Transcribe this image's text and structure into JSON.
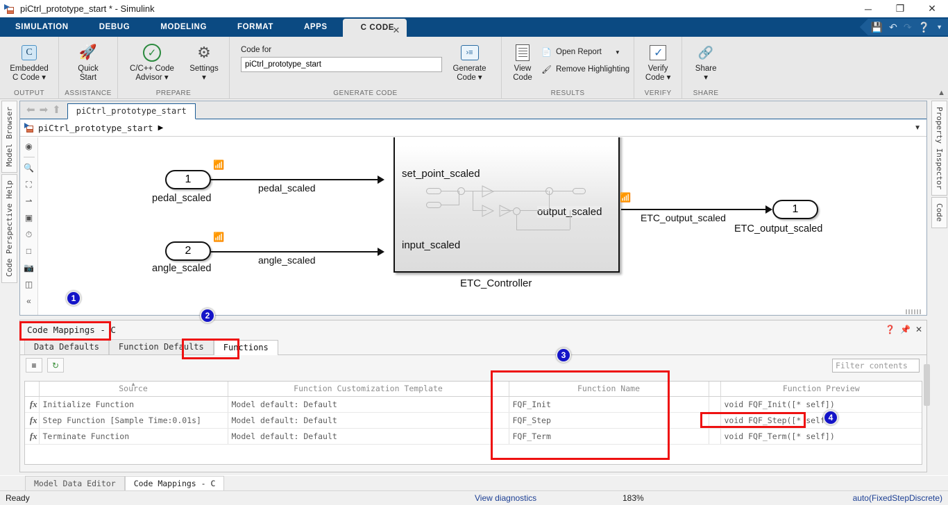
{
  "window": {
    "title": "piCtrl_prototype_start * - Simulink",
    "minimize": "─",
    "maximize": "❐",
    "close": "✕"
  },
  "ribbon_tabs": [
    {
      "label": "SIMULATION",
      "selected": false
    },
    {
      "label": "DEBUG",
      "selected": false
    },
    {
      "label": "MODELING",
      "selected": false
    },
    {
      "label": "FORMAT",
      "selected": false
    },
    {
      "label": "APPS",
      "selected": false
    },
    {
      "label": "C CODE",
      "selected": true
    }
  ],
  "quick_access": [
    "save-icon",
    "undo-icon",
    "redo-icon",
    "help-icon",
    "chevron-down-icon"
  ],
  "ribbon": {
    "groups": [
      {
        "name": "OUTPUT",
        "buttons": [
          {
            "label": "Embedded\nC Code ▾",
            "icon": "c-code-icon"
          }
        ]
      },
      {
        "name": "ASSISTANCE",
        "buttons": [
          {
            "label": "Quick\nStart",
            "icon": "rocket-icon"
          }
        ]
      },
      {
        "name": "PREPARE",
        "buttons": [
          {
            "label": "C/C++ Code\nAdvisor ▾",
            "icon": "check-circle-icon"
          },
          {
            "label": "Settings\n▾",
            "icon": "gear-icon"
          }
        ]
      },
      {
        "name": "GENERATE CODE",
        "code_for_label": "Code for",
        "code_for_value": "piCtrl_prototype_start",
        "buttons": [
          {
            "label": "Generate\nCode ▾",
            "icon": "generate-code-icon"
          }
        ]
      },
      {
        "name": "RESULTS",
        "buttons": [
          {
            "label": "View\nCode",
            "icon": "view-code-icon"
          }
        ],
        "small_items": [
          {
            "label": "Open Report",
            "icon": "report-icon",
            "has_dropdown": true
          },
          {
            "label": "Remove Highlighting",
            "icon": "remove-highlighting-icon",
            "has_dropdown": false
          }
        ]
      },
      {
        "name": "VERIFY",
        "buttons": [
          {
            "label": "Verify\nCode ▾",
            "icon": "verify-code-icon"
          }
        ]
      },
      {
        "name": "SHARE",
        "buttons": [
          {
            "label": "Share\n▾",
            "icon": "share-icon"
          }
        ]
      }
    ]
  },
  "left_sidebar": [
    {
      "label": "Model Browser"
    },
    {
      "label": "Code Perspective Help"
    }
  ],
  "right_sidebar": [
    {
      "label": "Property Inspector"
    },
    {
      "label": "Code"
    }
  ],
  "canvas": {
    "model_tab": "piCtrl_prototype_start",
    "breadcrumb": "piCtrl_prototype_start",
    "tool_icons": [
      "back-to-parent-icon",
      "zoom-icon",
      "fit-to-view-icon",
      "signal-routing-icon",
      "annotation-icon",
      "scope-icon",
      "subsystem-icon",
      "snapshot-icon",
      "model-slicer-icon",
      "collapse-icon"
    ],
    "blocks": {
      "inport1_number": "1",
      "inport1_label": "pedal_scaled",
      "inport2_number": "2",
      "inport2_label": "angle_scaled",
      "outport1_number": "1",
      "outport1_label": "ETC_output_scaled",
      "subsystem_name": "ETC_Controller",
      "subsystem_in1": "set_point_scaled",
      "subsystem_in2": "input_scaled",
      "subsystem_out1": "output_scaled"
    },
    "signals": {
      "sig1": "pedal_scaled",
      "sig2": "angle_scaled",
      "sig3": "ETC_output_scaled"
    }
  },
  "code_mappings": {
    "title": "Code Mappings - C",
    "header_buttons": [
      "help-icon",
      "pin-icon",
      "close-icon"
    ],
    "tabs": [
      {
        "label": "Data Defaults",
        "selected": false
      },
      {
        "label": "Function Defaults",
        "selected": false
      },
      {
        "label": "Functions",
        "selected": true
      }
    ],
    "toolbar_buttons": [
      "code-view-icon",
      "refresh-icon"
    ],
    "filter_placeholder": "Filter contents",
    "columns": [
      "",
      "Source",
      "Function Customization Template",
      "Function Name",
      "",
      "Function Preview"
    ],
    "sorted_column": "Source",
    "rows": [
      {
        "icon": "function-icon",
        "source": "Initialize Function",
        "template": "Model default: Default",
        "function_name": "FQF_Init",
        "preview": "void FQF_Init([* self])"
      },
      {
        "icon": "function-icon",
        "source": "Step Function [Sample Time:0.01s]",
        "template": "Model default: Default",
        "function_name": "FQF_Step",
        "preview": "void FQF_Step([* self])"
      },
      {
        "icon": "function-icon",
        "source": "Terminate Function",
        "template": "Model default: Default",
        "function_name": "FQF_Term",
        "preview": "void FQF_Term([* self])"
      }
    ]
  },
  "bottom_tabs": [
    {
      "label": "Model Data Editor",
      "selected": false
    },
    {
      "label": "Code Mappings - C",
      "selected": true
    }
  ],
  "status_bar": {
    "ready": "Ready",
    "diagnostics": "View diagnostics",
    "zoom": "183%",
    "solver": "auto(FixedStepDiscrete)"
  },
  "annotations": {
    "badges": [
      "1",
      "2",
      "3",
      "4"
    ],
    "accent_color": "#ee1111",
    "badge_color": "#1414c8"
  }
}
